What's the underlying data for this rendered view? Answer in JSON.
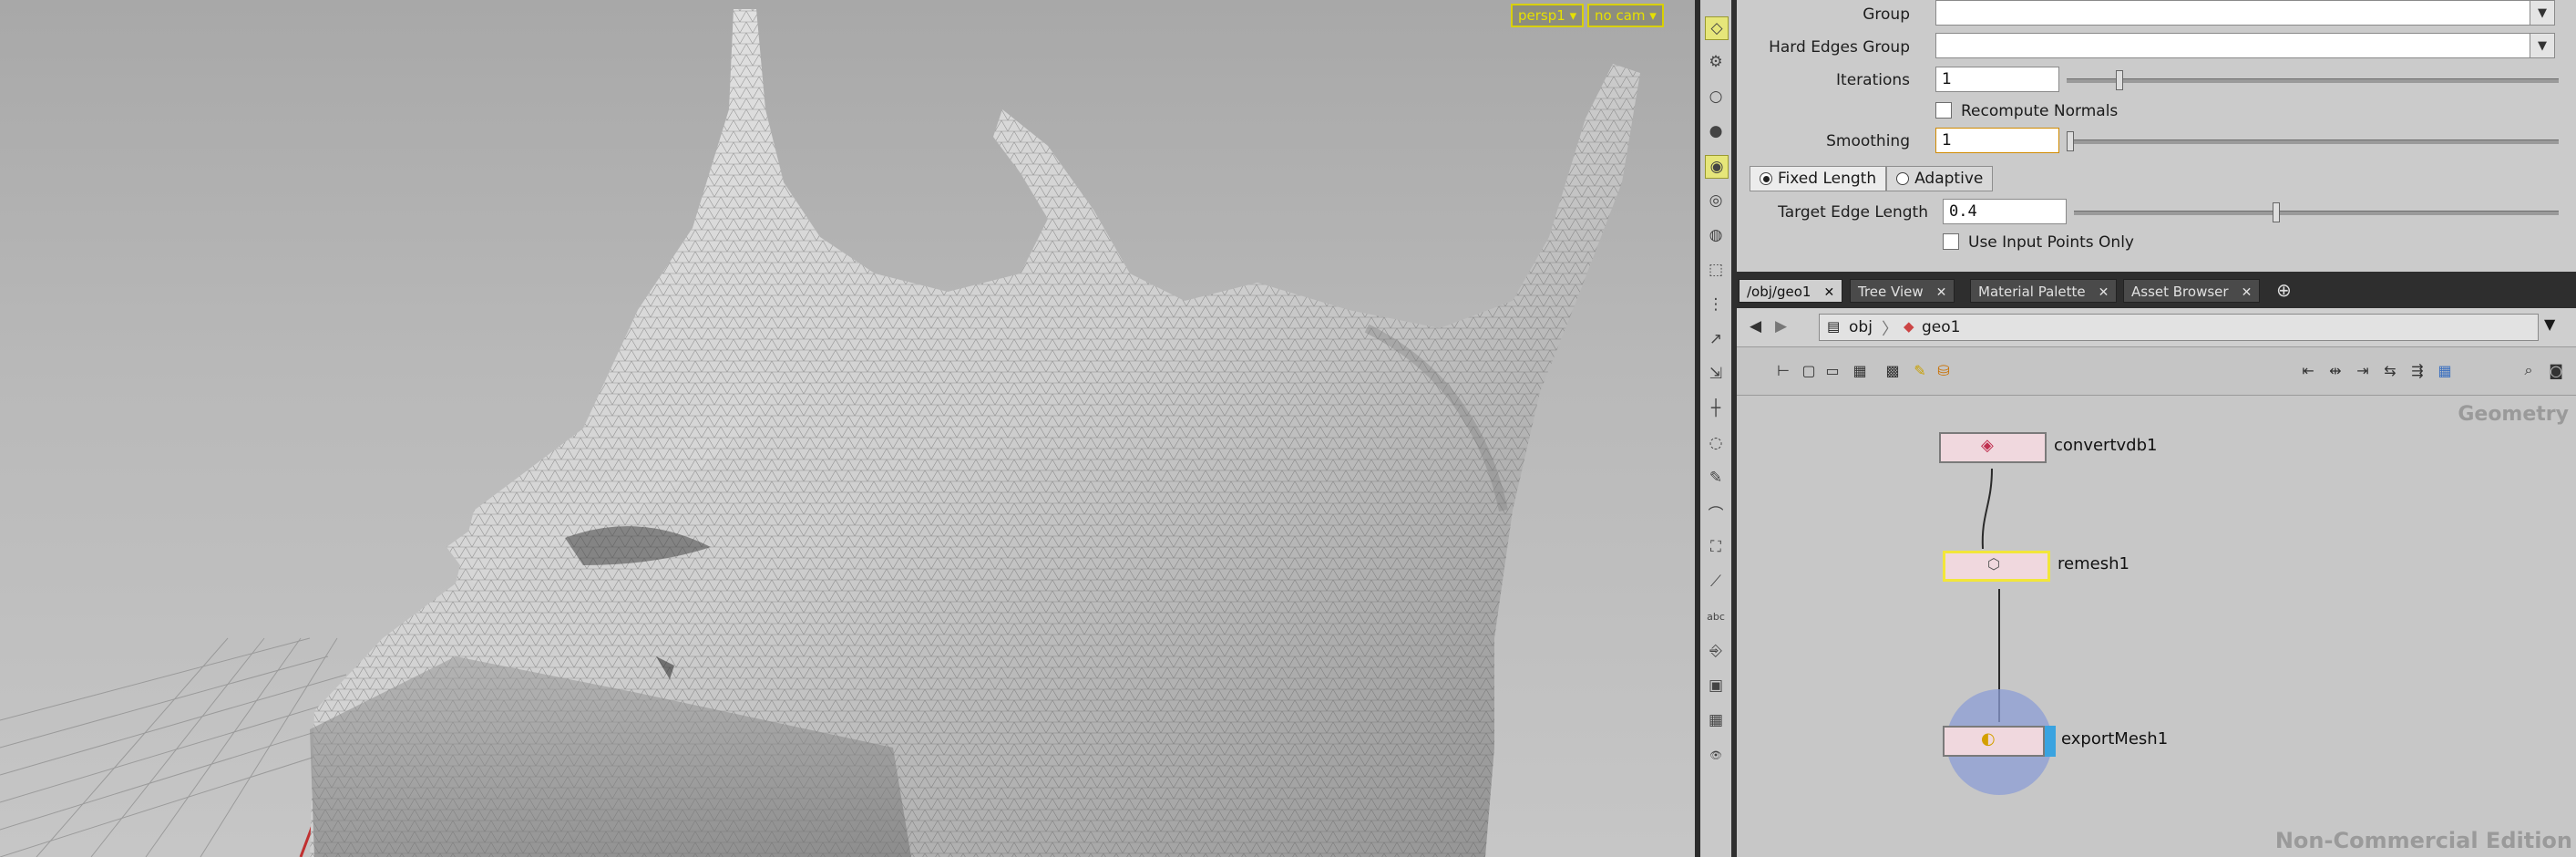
{
  "viewport": {
    "camera_menu": "persp1",
    "cam_menu": "no cam",
    "dropdown_glyph": "▾"
  },
  "shelf": {
    "icons": [
      "select-icon",
      "gear-icon",
      "circle-icon",
      "brush-icon",
      "smooth-icon",
      "sphere-icon",
      "sphere-alt-icon",
      "cube-icon",
      "dots-icon",
      "axis-icon",
      "scale-icon",
      "handle-icon",
      "lasso-icon",
      "paint-icon",
      "curve-icon",
      "fit-icon",
      "measure-icon",
      "abc-icon",
      "camera-icon",
      "image-icon",
      "grid-icon",
      "eye-icon"
    ],
    "glyphs": [
      "◇",
      "⚙",
      "○",
      "●",
      "◉",
      "◎",
      "◍",
      "⬚",
      "⋮",
      "↗",
      "⇲",
      "┼",
      "◌",
      "✎",
      "⌒",
      "⛶",
      "⟋",
      "abc",
      "⎆",
      "▣",
      "▦",
      "👁"
    ]
  },
  "params": {
    "group_label": "Group",
    "group_value": "",
    "hard_edges_label": "Hard Edges Group",
    "hard_edges_value": "",
    "iterations_label": "Iterations",
    "iterations_value": "1",
    "recompute_normals_label": "Recompute Normals",
    "smoothing_label": "Smoothing",
    "smoothing_value": "1",
    "fixed_length_label": "Fixed Length",
    "adaptive_label": "Adaptive",
    "target_edge_label": "Target Edge Length",
    "target_edge_value": "0.4",
    "use_input_points_label": "Use Input Points Only",
    "iterations_slider": 0.1,
    "smoothing_slider": 0.0,
    "target_edge_slider": 0.41
  },
  "tabs": [
    {
      "label": "/obj/geo1",
      "active": true
    },
    {
      "label": "Tree View",
      "active": false
    },
    {
      "label": "Material Palette",
      "active": false
    },
    {
      "label": "Asset Browser",
      "active": false
    }
  ],
  "tab_close": "✕",
  "tab_add": "⊕",
  "pathbar": {
    "back": "◀",
    "forward": "▶",
    "root": "obj",
    "current": "geo1"
  },
  "network": {
    "context_label": "Geometry",
    "nodes": [
      {
        "name": "convertvdb1"
      },
      {
        "name": "remesh1"
      },
      {
        "name": "exportMesh1"
      }
    ],
    "watermark": "Non-Commercial Edition"
  },
  "colors": {
    "node_highlight": "#f2e63a",
    "selected_node": "#8c9ed6",
    "display_flag": "#3aa3e0"
  }
}
